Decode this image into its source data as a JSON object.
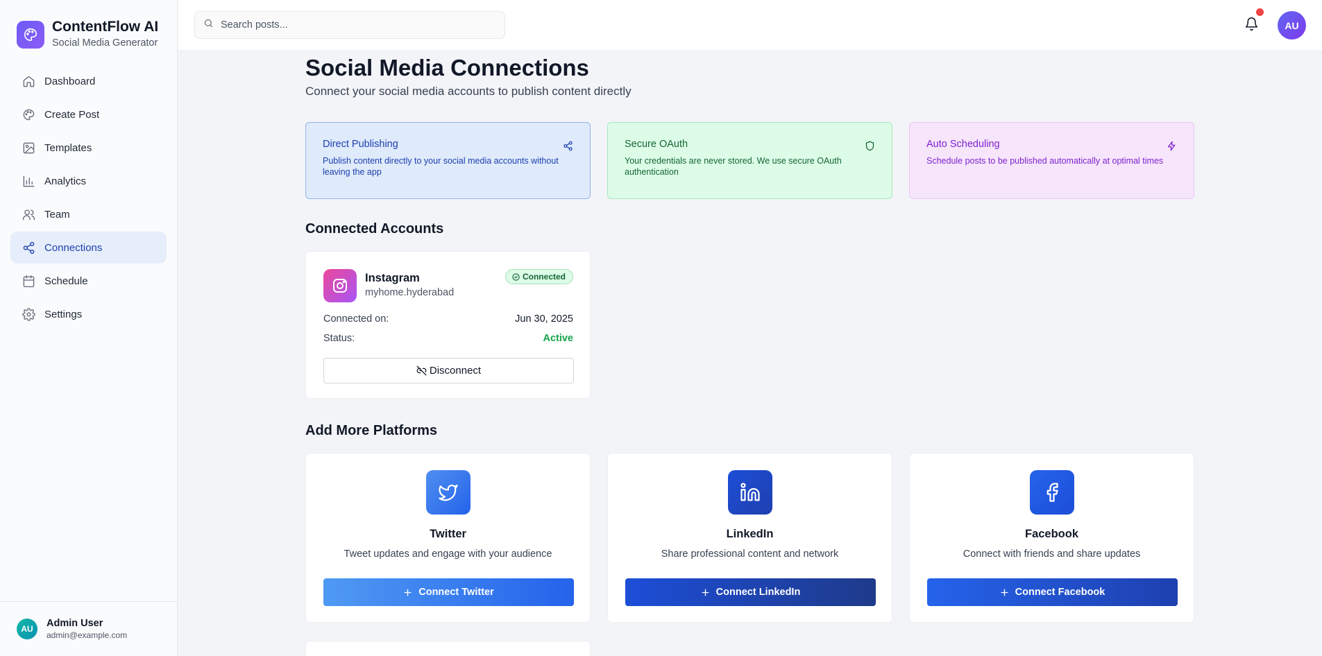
{
  "app": {
    "name": "ContentFlow AI",
    "tagline": "Social Media Generator",
    "logo_icon": "palette-icon",
    "accent": "#6d5cf6"
  },
  "sidebar": {
    "items": [
      {
        "label": "Dashboard",
        "icon": "home-icon",
        "active": false
      },
      {
        "label": "Create Post",
        "icon": "palette-icon",
        "active": false
      },
      {
        "label": "Templates",
        "icon": "image-icon",
        "active": false
      },
      {
        "label": "Analytics",
        "icon": "bar-chart-icon",
        "active": false
      },
      {
        "label": "Team",
        "icon": "users-icon",
        "active": false
      },
      {
        "label": "Connections",
        "icon": "share-icon",
        "active": true
      },
      {
        "label": "Schedule",
        "icon": "calendar-icon",
        "active": false
      },
      {
        "label": "Settings",
        "icon": "gear-icon",
        "active": false
      }
    ],
    "user": {
      "initials": "AU",
      "name": "Admin User",
      "email": "admin@example.com"
    }
  },
  "topbar": {
    "search_placeholder": "Search posts...",
    "avatar_initials": "AU",
    "notification_dot_color": "#ef4444"
  },
  "page": {
    "title": "Social Media Connections",
    "subtitle": "Connect your social media accounts to publish content directly"
  },
  "features": [
    {
      "title": "Direct Publishing",
      "description": "Publish content directly to your social media accounts without leaving the app",
      "icon": "share-icon"
    },
    {
      "title": "Secure OAuth",
      "description": "Your credentials are never stored. We use secure OAuth authentication",
      "icon": "shield-icon"
    },
    {
      "title": "Auto Scheduling",
      "description": "Schedule posts to be published automatically at optimal times",
      "icon": "lightning-icon"
    }
  ],
  "connected": {
    "section_title": "Connected Accounts",
    "accounts": [
      {
        "platform": "Instagram",
        "handle": "myhome.hyderabad",
        "badge": "Connected",
        "connected_on_label": "Connected on:",
        "connected_on": "Jun 30, 2025",
        "status_label": "Status:",
        "status": "Active",
        "disconnect_label": "Disconnect",
        "icon": "instagram-icon"
      }
    ]
  },
  "platforms": {
    "section_title": "Add More Platforms",
    "items": [
      {
        "name": "Twitter",
        "description": "Tweet updates and engage with your audience",
        "button": "Connect Twitter",
        "icon": "twitter-icon"
      },
      {
        "name": "LinkedIn",
        "description": "Share professional content and network",
        "button": "Connect LinkedIn",
        "icon": "linkedin-icon"
      },
      {
        "name": "Facebook",
        "description": "Connect with friends and share updates",
        "button": "Connect Facebook",
        "icon": "facebook-icon"
      }
    ]
  }
}
